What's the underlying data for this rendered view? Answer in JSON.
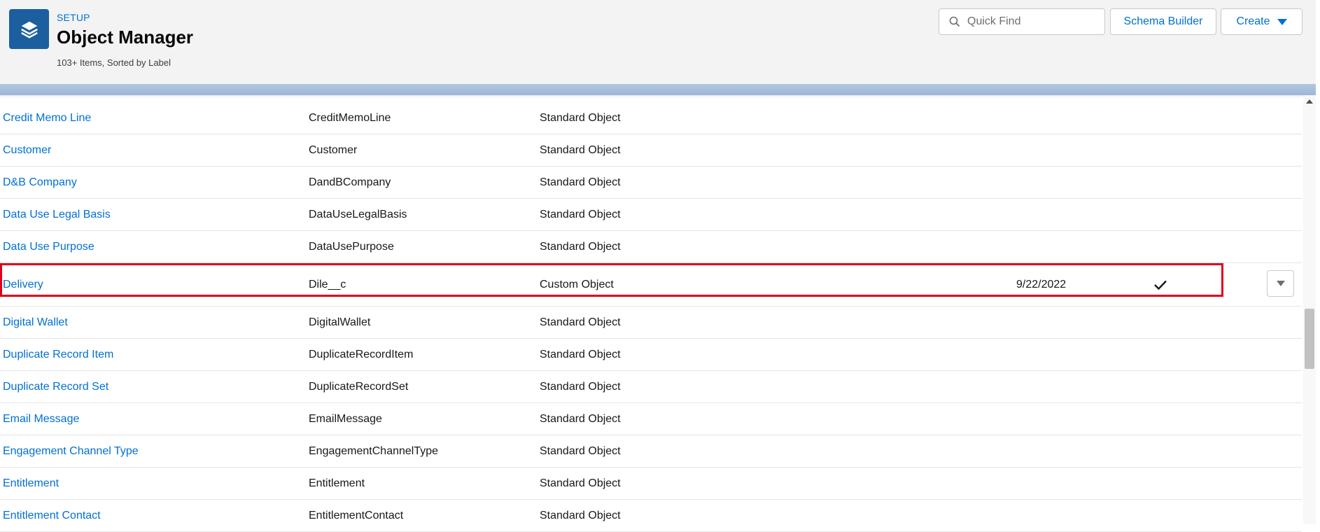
{
  "header": {
    "setup_label": "SETUP",
    "title": "Object Manager",
    "subtitle": "103+ Items, Sorted by Label",
    "icon": "layers-icon",
    "brand_color": "#1b5f9e"
  },
  "toolbar": {
    "quick_find_placeholder": "Quick Find",
    "quick_find_value": "",
    "schema_builder_label": "Schema Builder",
    "create_label": "Create"
  },
  "rows": [
    {
      "label": "Credit Memo Line",
      "api_name": "CreditMemoLine",
      "type": "Standard Object",
      "last_modified": "",
      "deployed": false
    },
    {
      "label": "Customer",
      "api_name": "Customer",
      "type": "Standard Object",
      "last_modified": "",
      "deployed": false
    },
    {
      "label": "D&B Company",
      "api_name": "DandBCompany",
      "type": "Standard Object",
      "last_modified": "",
      "deployed": false
    },
    {
      "label": "Data Use Legal Basis",
      "api_name": "DataUseLegalBasis",
      "type": "Standard Object",
      "last_modified": "",
      "deployed": false
    },
    {
      "label": "Data Use Purpose",
      "api_name": "DataUsePurpose",
      "type": "Standard Object",
      "last_modified": "",
      "deployed": false
    },
    {
      "label": "Delivery",
      "api_name": "Dile__c",
      "type": "Custom Object",
      "last_modified": "9/22/2022",
      "deployed": true
    },
    {
      "label": "Digital Wallet",
      "api_name": "DigitalWallet",
      "type": "Standard Object",
      "last_modified": "",
      "deployed": false
    },
    {
      "label": "Duplicate Record Item",
      "api_name": "DuplicateRecordItem",
      "type": "Standard Object",
      "last_modified": "",
      "deployed": false
    },
    {
      "label": "Duplicate Record Set",
      "api_name": "DuplicateRecordSet",
      "type": "Standard Object",
      "last_modified": "",
      "deployed": false
    },
    {
      "label": "Email Message",
      "api_name": "EmailMessage",
      "type": "Standard Object",
      "last_modified": "",
      "deployed": false
    },
    {
      "label": "Engagement Channel Type",
      "api_name": "EngagementChannelType",
      "type": "Standard Object",
      "last_modified": "",
      "deployed": false
    },
    {
      "label": "Entitlement",
      "api_name": "Entitlement",
      "type": "Standard Object",
      "last_modified": "",
      "deployed": false
    },
    {
      "label": "Entitlement Contact",
      "api_name": "EntitlementContact",
      "type": "Standard Object",
      "last_modified": "",
      "deployed": false
    }
  ],
  "highlight_color": "#e0001b",
  "link_color": "#0070d2"
}
